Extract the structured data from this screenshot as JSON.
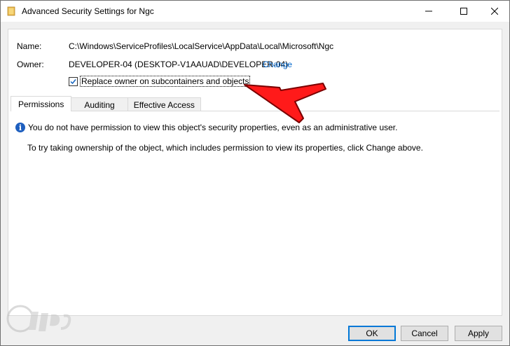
{
  "window": {
    "title": "Advanced Security Settings for Ngc"
  },
  "details": {
    "name_label": "Name:",
    "name_value": "C:\\Windows\\ServiceProfiles\\LocalService\\AppData\\Local\\Microsoft\\Ngc",
    "owner_label": "Owner:",
    "owner_value": "DEVELOPER-04 (DESKTOP-V1AAUAD\\DEVELOPER-04)",
    "change_link": "Change",
    "replace_owner_label": "Replace owner on subcontainers and objects",
    "replace_owner_checked": true
  },
  "tabs": [
    {
      "label": "Permissions",
      "active": true
    },
    {
      "label": "Auditing",
      "active": false
    },
    {
      "label": "Effective Access",
      "active": false
    }
  ],
  "panel": {
    "info_message": "You do not have permission to view this object's security properties, even as an administrative user.",
    "hint_message": "To try taking ownership of the object, which includes permission to view its properties, click Change above."
  },
  "buttons": {
    "ok": "OK",
    "cancel": "Cancel",
    "apply": "Apply"
  },
  "colors": {
    "accent": "#0078d7",
    "link": "#0066cc",
    "annotation_arrow": "#ff0000"
  }
}
